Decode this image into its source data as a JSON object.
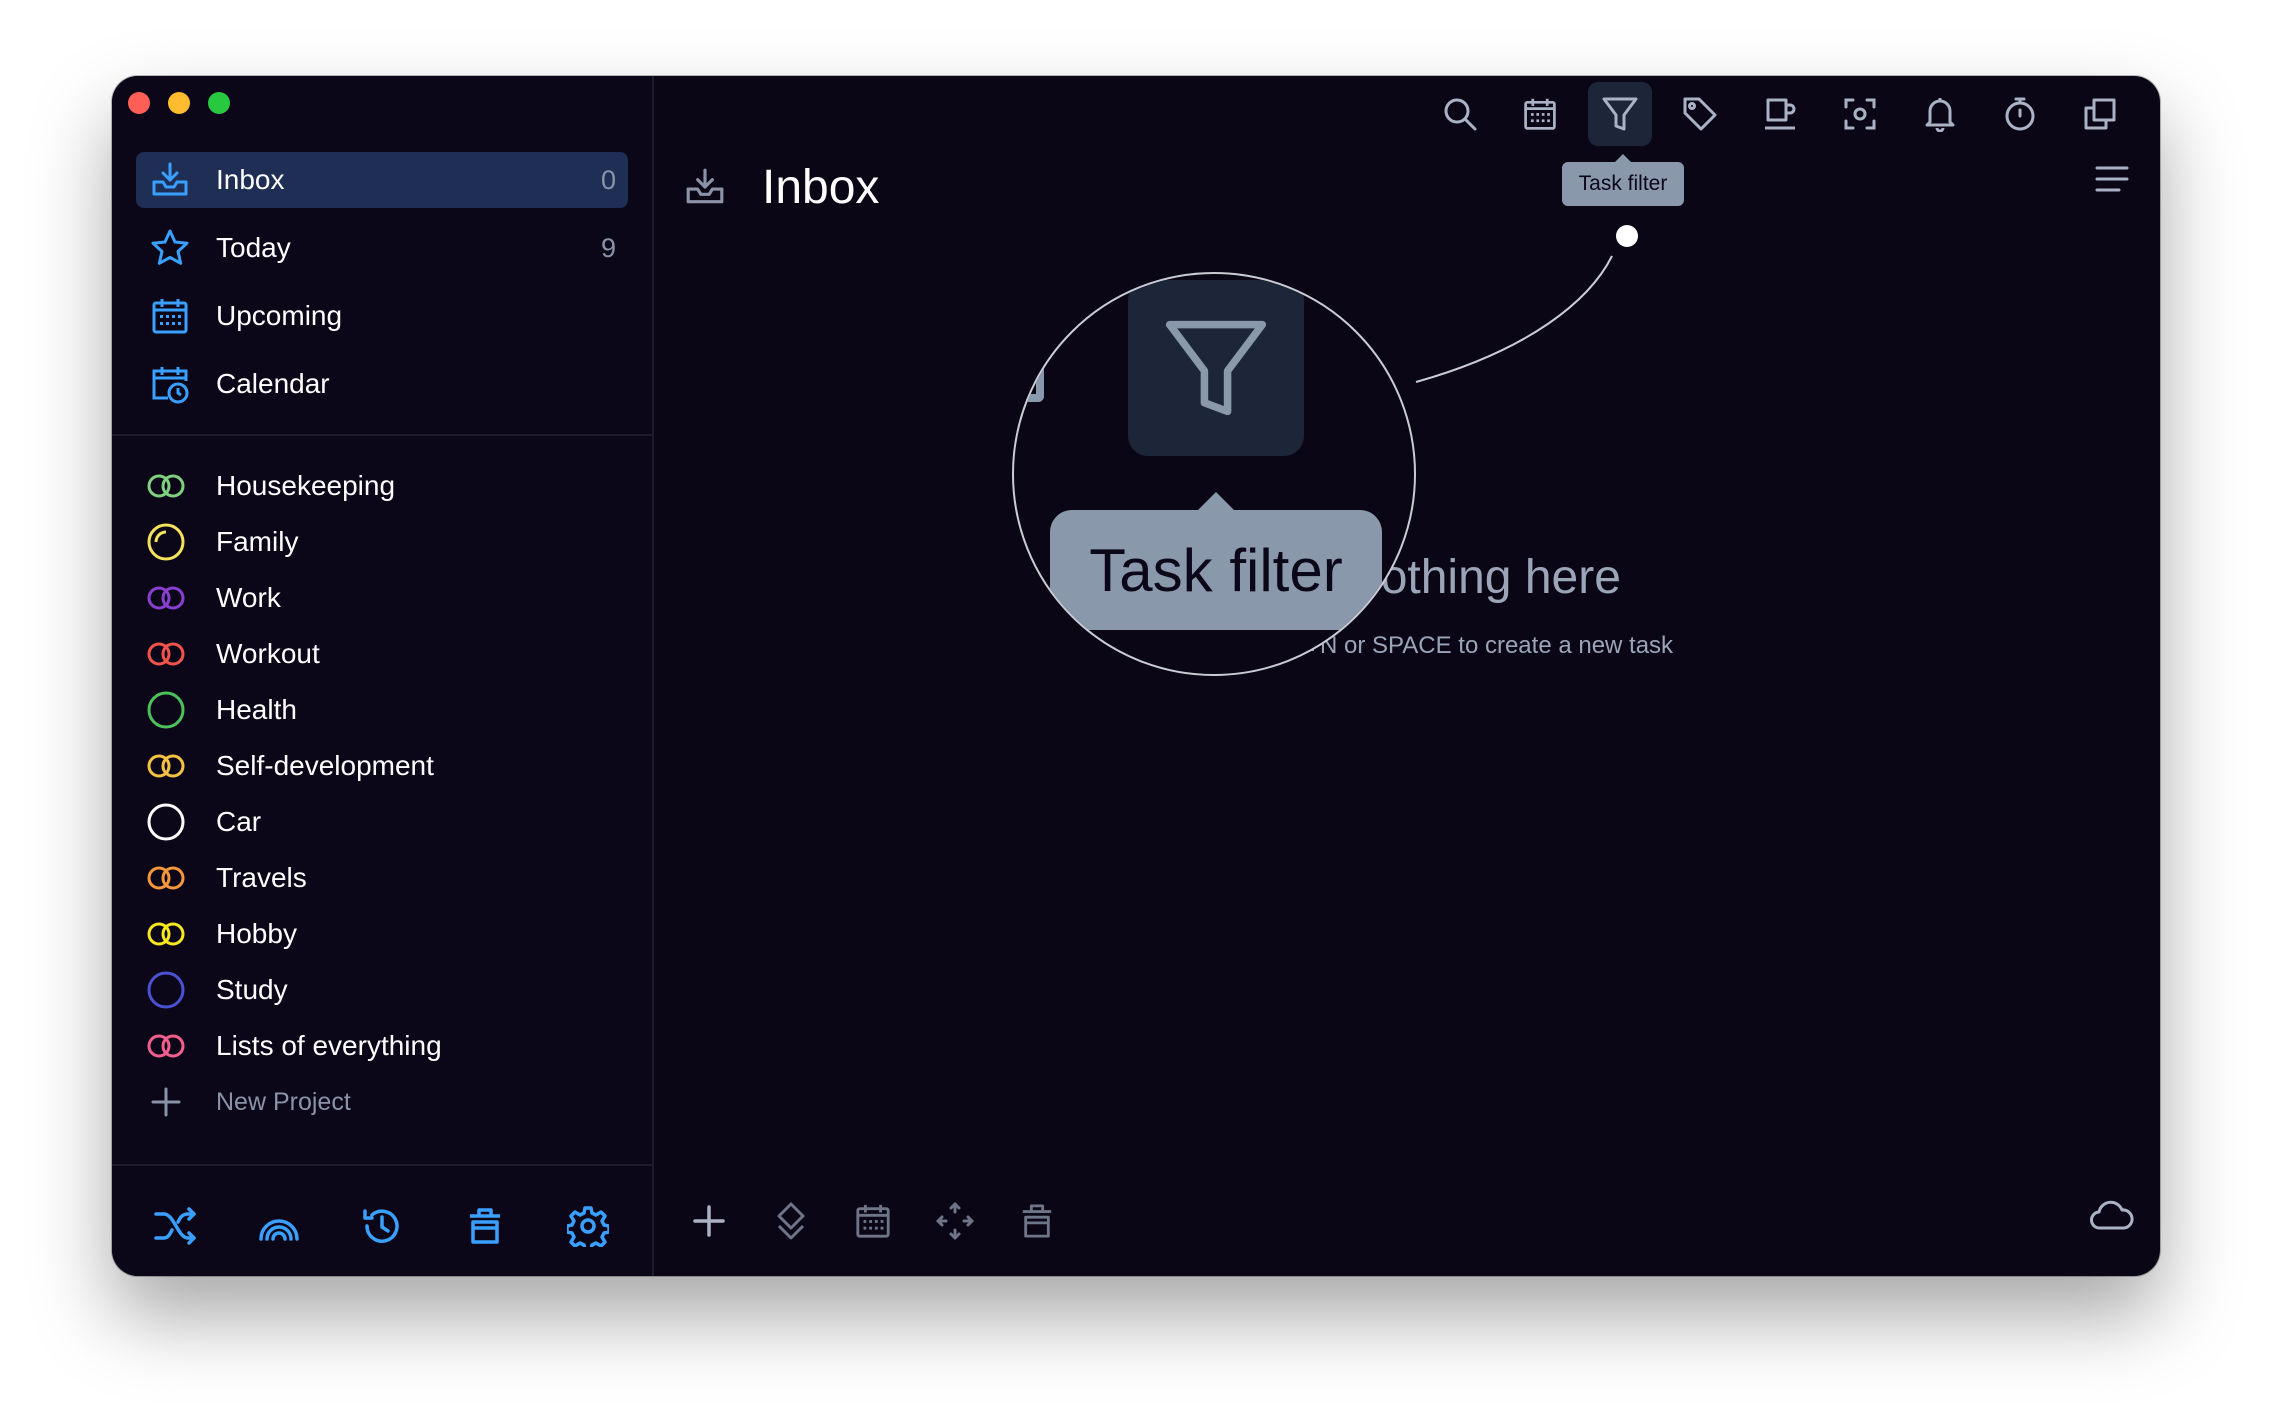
{
  "sidebar": {
    "nav": [
      {
        "label": "Inbox",
        "count": "0",
        "icon": "inbox-tray-icon"
      },
      {
        "label": "Today",
        "count": "9",
        "icon": "star-icon"
      },
      {
        "label": "Upcoming",
        "count": "",
        "icon": "calendar-grid-icon"
      },
      {
        "label": "Calendar",
        "count": "",
        "icon": "calendar-clock-icon"
      }
    ],
    "projects": [
      {
        "label": "Housekeeping",
        "color": "#7fd17f"
      },
      {
        "label": "Family",
        "color": "#f5e35c"
      },
      {
        "label": "Work",
        "color": "#8a3fd1"
      },
      {
        "label": "Workout",
        "color": "#f2544b"
      },
      {
        "label": "Health",
        "color": "#4ec25a"
      },
      {
        "label": "Self-development",
        "color": "#f5c242"
      },
      {
        "label": "Car",
        "color": "#ffffff"
      },
      {
        "label": "Travels",
        "color": "#f5973a"
      },
      {
        "label": "Hobby",
        "color": "#f5e81c"
      },
      {
        "label": "Study",
        "color": "#4a52d1"
      },
      {
        "label": "Lists of everything",
        "color": "#f25f8c"
      }
    ],
    "new_project_label": "New Project"
  },
  "main": {
    "title": "Inbox",
    "tooltip": "Task filter",
    "empty_title": "nothing here",
    "empty_sub": "+N or SPACE to create a new task",
    "magnified_tooltip": "Task filter"
  },
  "colors": {
    "accent": "#3aa0ff",
    "background": "#0a0616",
    "active_item": "#1e2e55",
    "tooltip_bg": "#8a98ac"
  }
}
